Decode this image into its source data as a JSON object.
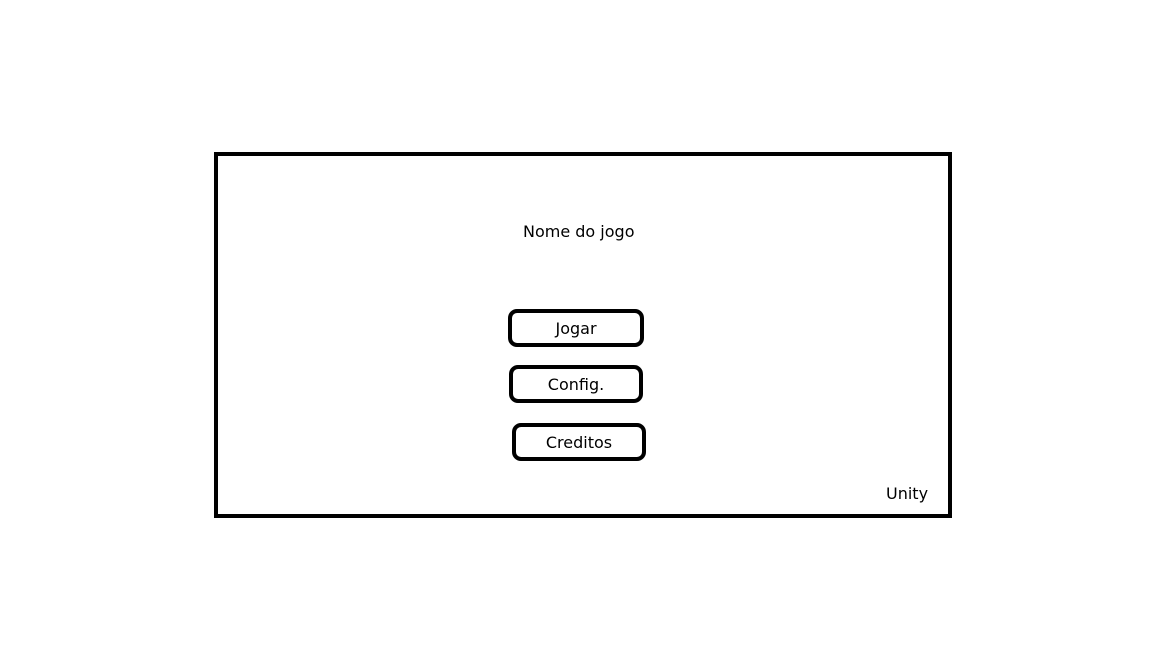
{
  "menu": {
    "title": "Nome do jogo",
    "buttons": {
      "play": "Jogar",
      "config": "Config.",
      "credits": "Creditos"
    },
    "engine": "Unity"
  },
  "colors": {
    "border": "#000000",
    "background": "#ffffff"
  }
}
